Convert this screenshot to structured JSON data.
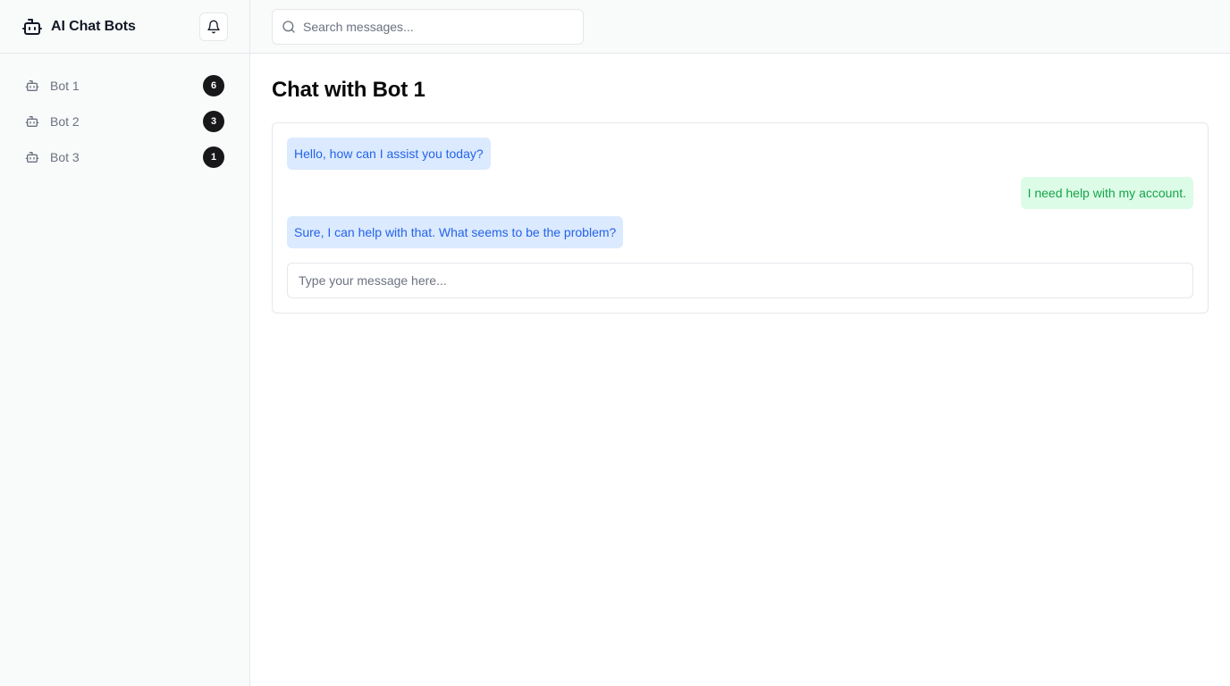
{
  "app": {
    "title": "AI Chat Bots",
    "brand_icon": "bot-icon",
    "notification_icon": "bell-icon"
  },
  "sidebar": {
    "items": [
      {
        "label": "Bot 1",
        "count": "6",
        "icon": "bot-icon"
      },
      {
        "label": "Bot 2",
        "count": "3",
        "icon": "bot-icon"
      },
      {
        "label": "Bot 3",
        "count": "1",
        "icon": "bot-icon"
      }
    ]
  },
  "search": {
    "placeholder": "Search messages...",
    "value": "",
    "icon": "search-icon"
  },
  "main": {
    "title": "Chat with Bot 1",
    "messages": [
      {
        "sender": "bot",
        "text": "Hello, how can I assist you today?"
      },
      {
        "sender": "user",
        "text": "I need help with my account."
      },
      {
        "sender": "bot",
        "text": "Sure, I can help with that. What seems to be the problem?"
      }
    ],
    "composer": {
      "placeholder": "Type your message here...",
      "value": ""
    }
  },
  "colors": {
    "bot_bubble_bg": "#dbeafe",
    "bot_bubble_text": "#2563eb",
    "user_bubble_bg": "#dcfce7",
    "user_bubble_text": "#16a34a",
    "badge_bg": "#18181b"
  }
}
